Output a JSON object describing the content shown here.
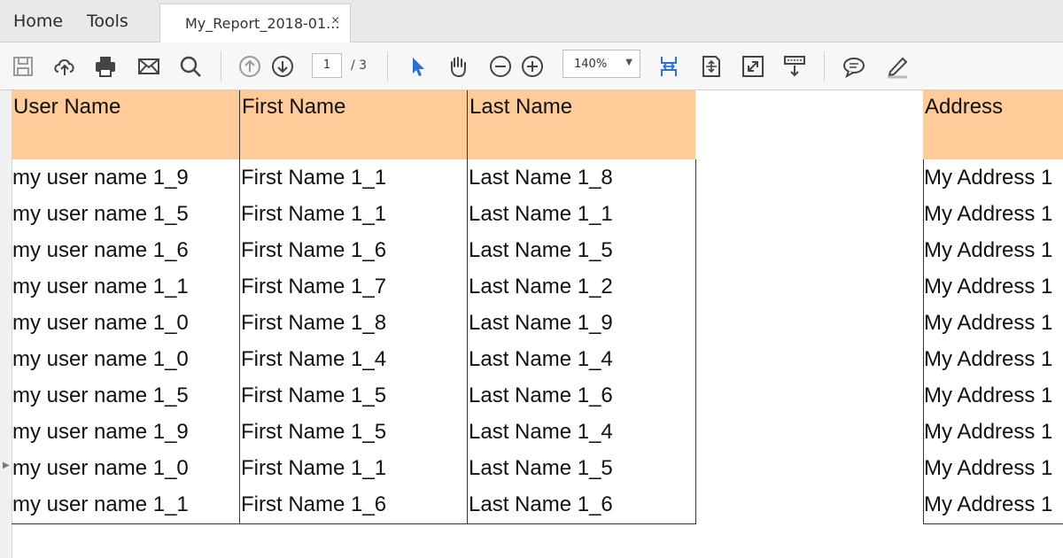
{
  "menubar": {
    "home": "Home",
    "tools": "Tools"
  },
  "tab": {
    "title": "My_Report_2018-01...",
    "close": "×"
  },
  "toolbar": {
    "page_current": "1",
    "page_total": "/ 3",
    "zoom": "140%",
    "zoom_caret": "▼",
    "accent_color": "#2a6fd6"
  },
  "table": {
    "headers": [
      "User Name",
      "First Name",
      "Last Name",
      "Address"
    ],
    "rows": [
      [
        "my user name 1_9",
        "First Name 1_1",
        "Last Name 1_8",
        "My Address 1"
      ],
      [
        "my user name 1_5",
        "First Name 1_1",
        "Last Name 1_1",
        "My Address 1"
      ],
      [
        "my user name 1_6",
        "First Name 1_6",
        "Last Name 1_5",
        "My Address 1"
      ],
      [
        "my user name 1_1",
        "First Name 1_7",
        "Last Name 1_2",
        "My Address 1"
      ],
      [
        "my user name 1_0",
        "First Name 1_8",
        "Last Name 1_9",
        "My Address 1"
      ],
      [
        "my user name 1_0",
        "First Name 1_4",
        "Last Name 1_4",
        "My Address 1"
      ],
      [
        "my user name 1_5",
        "First Name 1_5",
        "Last Name 1_6",
        "My Address 1"
      ],
      [
        "my user name 1_9",
        "First Name 1_5",
        "Last Name 1_4",
        "My Address 1"
      ],
      [
        "my user name 1_0",
        "First Name 1_1",
        "Last Name 1_5",
        "My Address 1"
      ],
      [
        "my user name 1_1",
        "First Name 1_6",
        "Last Name 1_6",
        "My Address 1"
      ]
    ],
    "header_color": "#ffcc99"
  }
}
